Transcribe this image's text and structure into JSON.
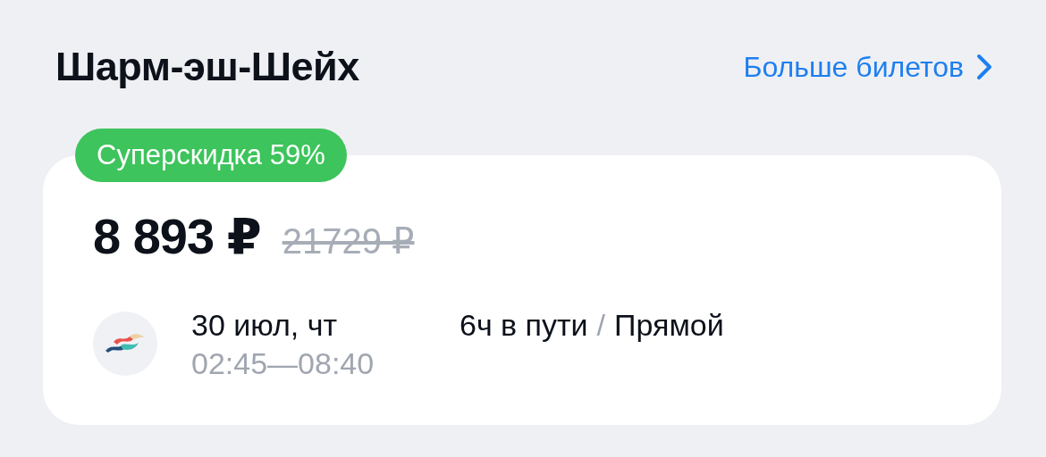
{
  "header": {
    "title": "Шарм-эш-Шейх",
    "more_link": "Больше билетов"
  },
  "offer": {
    "badge": "Суперскидка 59%",
    "price": "8 893 ₽",
    "old_price": "21729 ₽",
    "flight": {
      "date": "30 июл, чт",
      "times": "02:45—08:40",
      "duration": "6ч в пути",
      "separator": "/",
      "route_type": "Прямой"
    }
  }
}
